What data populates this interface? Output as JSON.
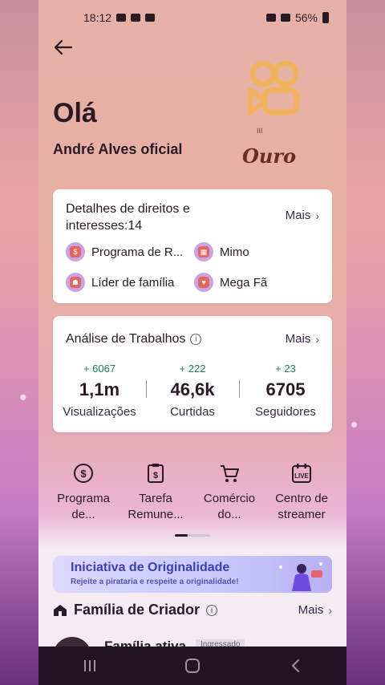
{
  "status_bar": {
    "time": "18:12",
    "battery": "56%"
  },
  "header": {
    "greeting": "Olá",
    "username": "André Alves oficial",
    "badge_level": "III",
    "badge_name": "Ouro"
  },
  "rights_card": {
    "title": "Detalhes de direitos e interesses:14",
    "more_label": "Mais",
    "perks": [
      {
        "label": "Programa de R...",
        "icon": "dollar-icon"
      },
      {
        "label": "Mimo",
        "icon": "gift-icon"
      },
      {
        "label": "Líder de família",
        "icon": "family-icon"
      },
      {
        "label": "Mega Fã",
        "icon": "fan-icon"
      }
    ]
  },
  "works_card": {
    "title": "Análise de Trabalhos",
    "more_label": "Mais",
    "stats": [
      {
        "delta": "+ 6067",
        "value": "1,1m",
        "label": "Visualizações"
      },
      {
        "delta": "+ 222",
        "value": "46,6k",
        "label": "Curtidas"
      },
      {
        "delta": "+ 23",
        "value": "6705",
        "label": "Seguidores"
      }
    ]
  },
  "shortcuts": [
    {
      "label_line1": "Programa",
      "label_line2": "de...",
      "icon": "dollar-circle-icon"
    },
    {
      "label_line1": "Tarefa",
      "label_line2": "Remune...",
      "icon": "task-money-icon"
    },
    {
      "label_line1": "Comércio",
      "label_line2": "do...",
      "icon": "cart-icon"
    },
    {
      "label_line1": "Centro de",
      "label_line2": "streamer",
      "icon": "live-calendar-icon"
    }
  ],
  "banner": {
    "title": "Iniciativa de Originalidade",
    "subtitle": "Rejeite a pirataria e respeite a originalidade!"
  },
  "family_section": {
    "title": "Família de Criador",
    "more_label": "Mais",
    "active_label": "Família ativa",
    "joined_tag": "Ingressado"
  },
  "colors": {
    "accent_green": "#1f7b5c",
    "banner_title": "#3d3fb6",
    "badge_gold": "#e8a048"
  }
}
